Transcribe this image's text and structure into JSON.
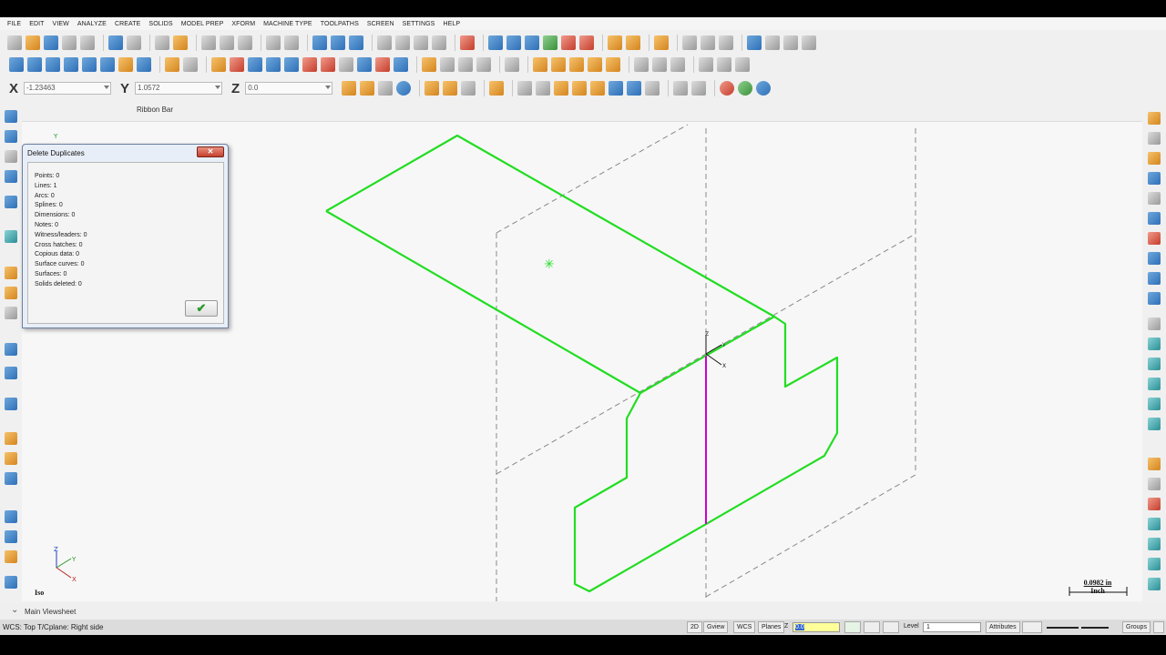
{
  "menu": [
    "FILE",
    "EDIT",
    "VIEW",
    "ANALYZE",
    "CREATE",
    "SOLIDS",
    "MODEL PREP",
    "XFORM",
    "MACHINE TYPE",
    "TOOLPATHS",
    "SCREEN",
    "SETTINGS",
    "HELP"
  ],
  "coords": {
    "x_label": "X",
    "x_value": "-1.23463",
    "y_label": "Y",
    "y_value": "1.0572",
    "z_label": "Z",
    "z_value": "0.0"
  },
  "ribbon_label": "Ribbon Bar",
  "dialog": {
    "title": "Delete Duplicates",
    "close_label": "✕",
    "items": [
      "Points: 0",
      "Lines: 1",
      "Arcs: 0",
      "Splines: 0",
      "Dimensions: 0",
      "Notes: 0",
      "Witness/leaders: 0",
      "Cross hatches: 0",
      "Copious data: 0",
      "Surface curves: 0",
      "Surfaces: 0",
      "Solids deleted: 0"
    ],
    "ok_label": "✔"
  },
  "view_name": "Iso",
  "scale": {
    "value": "0.0982 in",
    "unit": "Inch"
  },
  "viewsheet_tab": "Main Viewsheet",
  "status": {
    "wcs_text": "WCS: Top  T/Cplane: Right side",
    "btn_2d": "2D",
    "gview": "Gview",
    "wcs": "WCS",
    "planes": "Planes",
    "z_label": "Z",
    "z_value": "0.0",
    "level_label": "Level",
    "level_value": "1",
    "attributes": "Attributes",
    "groups": "Groups"
  },
  "axis_labels": {
    "x": "X",
    "y": "Y",
    "z": "Z"
  },
  "colors": {
    "geometry": "#22dd22",
    "vertical_line": "#cc00cc",
    "viewport_bg": "#f7f7f7"
  }
}
